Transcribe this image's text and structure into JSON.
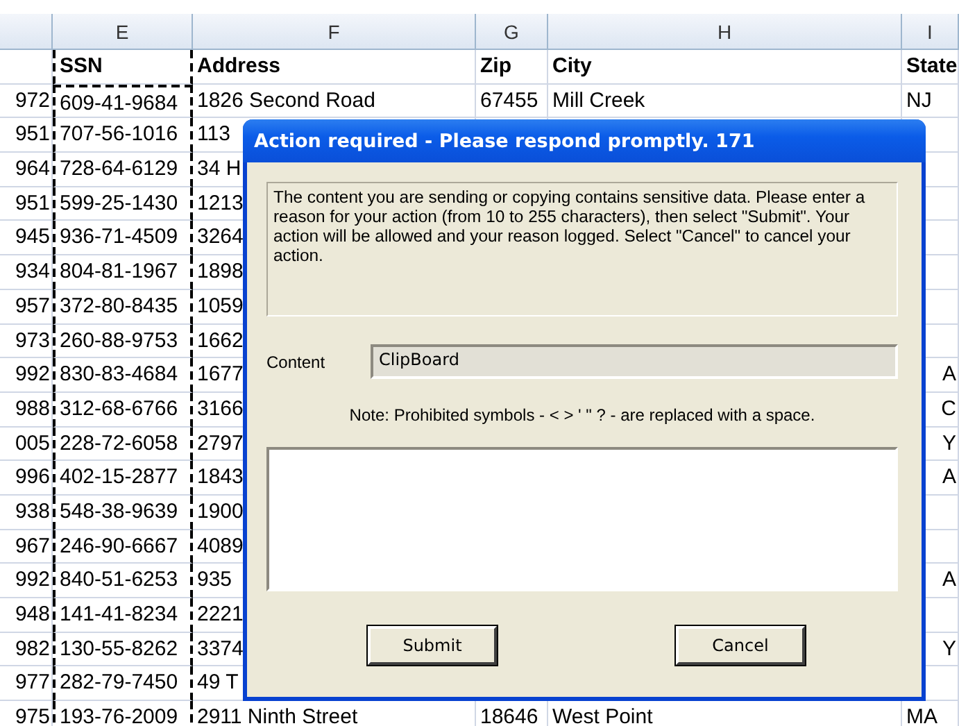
{
  "sheet": {
    "column_letters": [
      "E",
      "F",
      "G",
      "H",
      "I"
    ],
    "header": [
      "SSN",
      "Address",
      "Zip",
      "City",
      "State"
    ],
    "rows": [
      {
        "cells": [
          "972",
          "609-41-9684",
          "1826 Second Road",
          "67455",
          "Mill Creek",
          "NJ"
        ]
      },
      {
        "cells": [
          "951",
          "707-56-1016",
          "113"
        ]
      },
      {
        "cells": [
          "964",
          "728-64-6129",
          "34 H"
        ]
      },
      {
        "cells": [
          "951",
          "599-25-1430",
          "1213"
        ]
      },
      {
        "cells": [
          "945",
          "936-71-4509",
          "3264"
        ]
      },
      {
        "cells": [
          "934",
          "804-81-1967",
          "1898"
        ]
      },
      {
        "cells": [
          "957",
          "372-80-8435",
          "1059"
        ]
      },
      {
        "cells": [
          "973",
          "260-88-9753",
          "1662"
        ]
      },
      {
        "cells": [
          "992",
          "830-83-4684",
          "1677"
        ],
        "state_tail": "A"
      },
      {
        "cells": [
          "988",
          "312-68-6766",
          "3166"
        ],
        "state_tail": "C"
      },
      {
        "cells": [
          "005",
          "228-72-6058",
          "2797"
        ],
        "state_tail": "Y"
      },
      {
        "cells": [
          "996",
          "402-15-2877",
          "1843"
        ],
        "state_tail": "A"
      },
      {
        "cells": [
          "938",
          "548-38-9639",
          "1900"
        ]
      },
      {
        "cells": [
          "967",
          "246-90-6667",
          "4089"
        ]
      },
      {
        "cells": [
          "992",
          "840-51-6253",
          "935"
        ],
        "state_tail": "A"
      },
      {
        "cells": [
          "948",
          "141-41-8234",
          "2221"
        ]
      },
      {
        "cells": [
          "982",
          "130-55-8262",
          "3374"
        ],
        "state_tail": "Y"
      },
      {
        "cells": [
          "977",
          "282-79-7450",
          "49 T"
        ]
      },
      {
        "cells": [
          "975",
          "193-76-2009",
          "2911 Ninth Street",
          "18646",
          "West Point",
          "MA"
        ]
      }
    ]
  },
  "dialog": {
    "title": "Action required - Please respond promptly. 171",
    "message": "The content you are sending or copying contains sensitive data. Please enter a reason for your action (from 10 to 255 characters), then select \"Submit\". Your action will be allowed and your reason logged. Select \"Cancel\" to cancel your action.",
    "content_label": "Content",
    "content_value": "ClipBoard",
    "note": "Note: Prohibited symbols - < > ' \" ? - are replaced with a space.",
    "buttons": [
      "Submit",
      "Cancel"
    ]
  }
}
